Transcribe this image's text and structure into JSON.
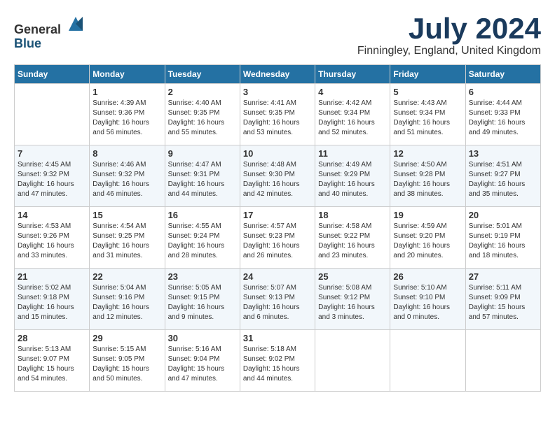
{
  "header": {
    "logo_general": "General",
    "logo_blue": "Blue",
    "month_title": "July 2024",
    "location": "Finningley, England, United Kingdom"
  },
  "days_of_week": [
    "Sunday",
    "Monday",
    "Tuesday",
    "Wednesday",
    "Thursday",
    "Friday",
    "Saturday"
  ],
  "weeks": [
    [
      {
        "day": "",
        "sunrise": "",
        "sunset": "",
        "daylight": ""
      },
      {
        "day": "1",
        "sunrise": "Sunrise: 4:39 AM",
        "sunset": "Sunset: 9:36 PM",
        "daylight": "Daylight: 16 hours and 56 minutes."
      },
      {
        "day": "2",
        "sunrise": "Sunrise: 4:40 AM",
        "sunset": "Sunset: 9:35 PM",
        "daylight": "Daylight: 16 hours and 55 minutes."
      },
      {
        "day": "3",
        "sunrise": "Sunrise: 4:41 AM",
        "sunset": "Sunset: 9:35 PM",
        "daylight": "Daylight: 16 hours and 53 minutes."
      },
      {
        "day": "4",
        "sunrise": "Sunrise: 4:42 AM",
        "sunset": "Sunset: 9:34 PM",
        "daylight": "Daylight: 16 hours and 52 minutes."
      },
      {
        "day": "5",
        "sunrise": "Sunrise: 4:43 AM",
        "sunset": "Sunset: 9:34 PM",
        "daylight": "Daylight: 16 hours and 51 minutes."
      },
      {
        "day": "6",
        "sunrise": "Sunrise: 4:44 AM",
        "sunset": "Sunset: 9:33 PM",
        "daylight": "Daylight: 16 hours and 49 minutes."
      }
    ],
    [
      {
        "day": "7",
        "sunrise": "Sunrise: 4:45 AM",
        "sunset": "Sunset: 9:32 PM",
        "daylight": "Daylight: 16 hours and 47 minutes."
      },
      {
        "day": "8",
        "sunrise": "Sunrise: 4:46 AM",
        "sunset": "Sunset: 9:32 PM",
        "daylight": "Daylight: 16 hours and 46 minutes."
      },
      {
        "day": "9",
        "sunrise": "Sunrise: 4:47 AM",
        "sunset": "Sunset: 9:31 PM",
        "daylight": "Daylight: 16 hours and 44 minutes."
      },
      {
        "day": "10",
        "sunrise": "Sunrise: 4:48 AM",
        "sunset": "Sunset: 9:30 PM",
        "daylight": "Daylight: 16 hours and 42 minutes."
      },
      {
        "day": "11",
        "sunrise": "Sunrise: 4:49 AM",
        "sunset": "Sunset: 9:29 PM",
        "daylight": "Daylight: 16 hours and 40 minutes."
      },
      {
        "day": "12",
        "sunrise": "Sunrise: 4:50 AM",
        "sunset": "Sunset: 9:28 PM",
        "daylight": "Daylight: 16 hours and 38 minutes."
      },
      {
        "day": "13",
        "sunrise": "Sunrise: 4:51 AM",
        "sunset": "Sunset: 9:27 PM",
        "daylight": "Daylight: 16 hours and 35 minutes."
      }
    ],
    [
      {
        "day": "14",
        "sunrise": "Sunrise: 4:53 AM",
        "sunset": "Sunset: 9:26 PM",
        "daylight": "Daylight: 16 hours and 33 minutes."
      },
      {
        "day": "15",
        "sunrise": "Sunrise: 4:54 AM",
        "sunset": "Sunset: 9:25 PM",
        "daylight": "Daylight: 16 hours and 31 minutes."
      },
      {
        "day": "16",
        "sunrise": "Sunrise: 4:55 AM",
        "sunset": "Sunset: 9:24 PM",
        "daylight": "Daylight: 16 hours and 28 minutes."
      },
      {
        "day": "17",
        "sunrise": "Sunrise: 4:57 AM",
        "sunset": "Sunset: 9:23 PM",
        "daylight": "Daylight: 16 hours and 26 minutes."
      },
      {
        "day": "18",
        "sunrise": "Sunrise: 4:58 AM",
        "sunset": "Sunset: 9:22 PM",
        "daylight": "Daylight: 16 hours and 23 minutes."
      },
      {
        "day": "19",
        "sunrise": "Sunrise: 4:59 AM",
        "sunset": "Sunset: 9:20 PM",
        "daylight": "Daylight: 16 hours and 20 minutes."
      },
      {
        "day": "20",
        "sunrise": "Sunrise: 5:01 AM",
        "sunset": "Sunset: 9:19 PM",
        "daylight": "Daylight: 16 hours and 18 minutes."
      }
    ],
    [
      {
        "day": "21",
        "sunrise": "Sunrise: 5:02 AM",
        "sunset": "Sunset: 9:18 PM",
        "daylight": "Daylight: 16 hours and 15 minutes."
      },
      {
        "day": "22",
        "sunrise": "Sunrise: 5:04 AM",
        "sunset": "Sunset: 9:16 PM",
        "daylight": "Daylight: 16 hours and 12 minutes."
      },
      {
        "day": "23",
        "sunrise": "Sunrise: 5:05 AM",
        "sunset": "Sunset: 9:15 PM",
        "daylight": "Daylight: 16 hours and 9 minutes."
      },
      {
        "day": "24",
        "sunrise": "Sunrise: 5:07 AM",
        "sunset": "Sunset: 9:13 PM",
        "daylight": "Daylight: 16 hours and 6 minutes."
      },
      {
        "day": "25",
        "sunrise": "Sunrise: 5:08 AM",
        "sunset": "Sunset: 9:12 PM",
        "daylight": "Daylight: 16 hours and 3 minutes."
      },
      {
        "day": "26",
        "sunrise": "Sunrise: 5:10 AM",
        "sunset": "Sunset: 9:10 PM",
        "daylight": "Daylight: 16 hours and 0 minutes."
      },
      {
        "day": "27",
        "sunrise": "Sunrise: 5:11 AM",
        "sunset": "Sunset: 9:09 PM",
        "daylight": "Daylight: 15 hours and 57 minutes."
      }
    ],
    [
      {
        "day": "28",
        "sunrise": "Sunrise: 5:13 AM",
        "sunset": "Sunset: 9:07 PM",
        "daylight": "Daylight: 15 hours and 54 minutes."
      },
      {
        "day": "29",
        "sunrise": "Sunrise: 5:15 AM",
        "sunset": "Sunset: 9:05 PM",
        "daylight": "Daylight: 15 hours and 50 minutes."
      },
      {
        "day": "30",
        "sunrise": "Sunrise: 5:16 AM",
        "sunset": "Sunset: 9:04 PM",
        "daylight": "Daylight: 15 hours and 47 minutes."
      },
      {
        "day": "31",
        "sunrise": "Sunrise: 5:18 AM",
        "sunset": "Sunset: 9:02 PM",
        "daylight": "Daylight: 15 hours and 44 minutes."
      },
      {
        "day": "",
        "sunrise": "",
        "sunset": "",
        "daylight": ""
      },
      {
        "day": "",
        "sunrise": "",
        "sunset": "",
        "daylight": ""
      },
      {
        "day": "",
        "sunrise": "",
        "sunset": "",
        "daylight": ""
      }
    ]
  ]
}
